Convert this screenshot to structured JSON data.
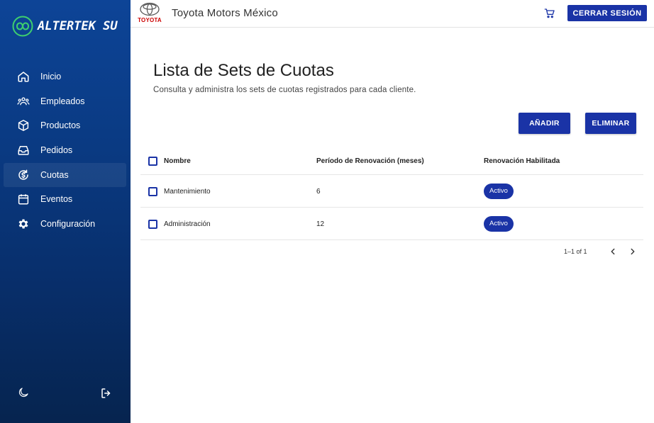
{
  "brand": {
    "logo_text": "ALTERTEK SU"
  },
  "sidebar": {
    "items": [
      {
        "label": "Inicio",
        "icon": "home-icon",
        "active": false
      },
      {
        "label": "Empleados",
        "icon": "people-icon",
        "active": false
      },
      {
        "label": "Productos",
        "icon": "box-icon",
        "active": false
      },
      {
        "label": "Pedidos",
        "icon": "inbox-icon",
        "active": false
      },
      {
        "label": "Cuotas",
        "icon": "dollar-cycle-icon",
        "active": true
      },
      {
        "label": "Eventos",
        "icon": "calendar-icon",
        "active": false
      },
      {
        "label": "Configuración",
        "icon": "gear-icon",
        "active": false
      }
    ],
    "bottom_icons": [
      "moon-icon",
      "logout-icon"
    ]
  },
  "header": {
    "client_logo_word": "TOYOTA",
    "company": "Toyota Motors México",
    "cart_icon": "cart-icon",
    "logout_label": "CERRAR SESIÓN"
  },
  "main": {
    "title": "Lista de Sets de Cuotas",
    "subtitle": "Consulta y administra los sets de cuotas registrados para cada cliente.",
    "add_label": "AÑADIR",
    "delete_label": "ELIMINAR",
    "table": {
      "headers": [
        "Nombre",
        "Período de Renovación (meses)",
        "Renovación Habilitada"
      ],
      "rows": [
        {
          "name": "Mantenimiento",
          "period": "6",
          "status": "Activo"
        },
        {
          "name": "Administración",
          "period": "12",
          "status": "Activo"
        }
      ]
    },
    "pagination": {
      "range": "1–1 of 1"
    }
  },
  "colors": {
    "primary": "#1a33a6",
    "sidebar_top": "#0d4497",
    "sidebar_bottom": "#06244f",
    "logo_green": "#3ecf6e"
  }
}
